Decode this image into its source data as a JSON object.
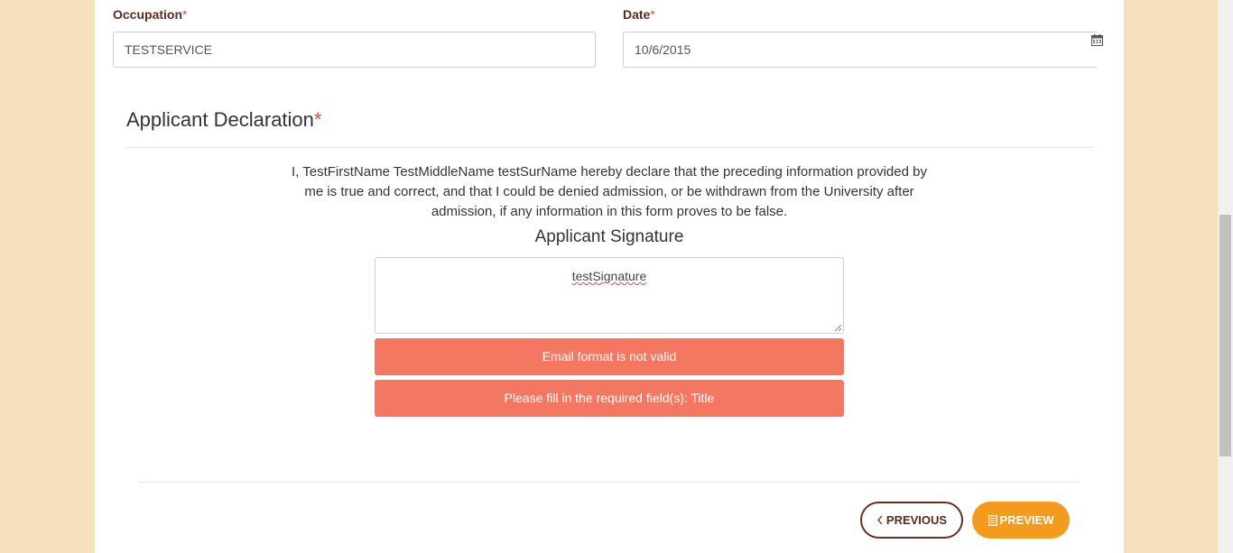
{
  "form": {
    "occupation": {
      "label": "Occupation",
      "required_mark": "*",
      "value": "TESTSERVICE"
    },
    "date": {
      "label": "Date",
      "required_mark": "*",
      "value": "10/6/2015",
      "icon": "calendar-icon"
    }
  },
  "declaration": {
    "title": "Applicant Declaration",
    "required_mark": "*",
    "text": "I, TestFirstName TestMiddleName testSurName hereby declare that the preceding information provided by me is true and correct, and that I could be denied admission, or be withdrawn from the University after admission, if any information in this form proves to be false.",
    "signature_label": "Applicant Signature",
    "signature_value": "testSignature"
  },
  "alerts": [
    {
      "message": "Email format is not valid"
    },
    {
      "message": "Please fill in the required field(s): Title"
    }
  ],
  "buttons": {
    "previous": {
      "label": "PREVIOUS",
      "icon": "chevron-left-icon"
    },
    "preview": {
      "label": "PREVIEW",
      "icon": "document-icon"
    }
  },
  "colors": {
    "page_background": "#f6e0bd",
    "label_brown": "#5c2a1e",
    "required_red": "#e0453a",
    "alert_bg": "#f47861",
    "preview_orange": "#f29b1d"
  }
}
